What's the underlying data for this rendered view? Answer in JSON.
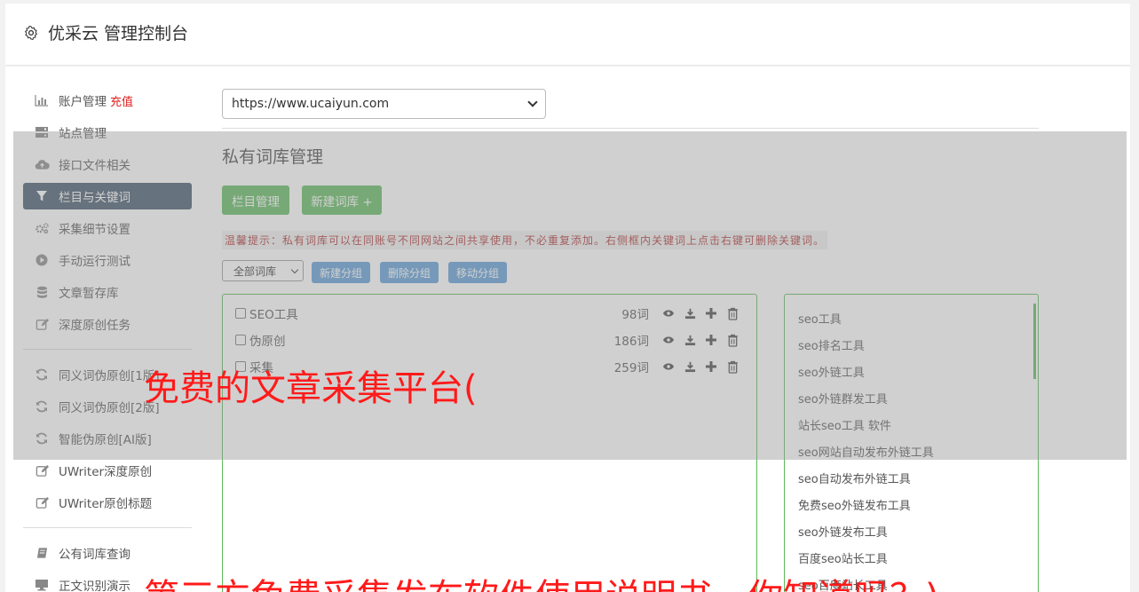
{
  "header": {
    "title": "优采云 管理控制台",
    "icon": "gear-icon"
  },
  "sidebar": {
    "groups": [
      [
        {
          "icon": "bar-chart-icon",
          "label": "账户管理",
          "badge": "充值"
        },
        {
          "icon": "server-icon",
          "label": "站点管理"
        },
        {
          "icon": "cloud-upload-icon",
          "label": "接口文件相关"
        },
        {
          "icon": "filter-icon",
          "label": "栏目与关键词",
          "active": true
        },
        {
          "icon": "cogs-icon",
          "label": "采集细节设置"
        },
        {
          "icon": "play-circle-icon",
          "label": "手动运行测试"
        },
        {
          "icon": "database-icon",
          "label": "文章暂存库"
        },
        {
          "icon": "edit-icon",
          "label": "深度原创任务"
        }
      ],
      [
        {
          "icon": "refresh-icon",
          "label": "同义词伪原创[1版]"
        },
        {
          "icon": "refresh-icon",
          "label": "同义词伪原创[2版]"
        },
        {
          "icon": "refresh-icon",
          "label": "智能伪原创[AI版]"
        },
        {
          "icon": "edit-icon",
          "label": "UWriter深度原创"
        },
        {
          "icon": "edit-icon",
          "label": "UWriter原创标题"
        }
      ],
      [
        {
          "icon": "book-icon",
          "label": "公有词库查询"
        },
        {
          "icon": "monitor-icon",
          "label": "正文识别演示"
        }
      ]
    ]
  },
  "content": {
    "site_select": {
      "value": "https://www.ucaiyun.com"
    },
    "section_title": "私有词库管理",
    "buttons": {
      "column_manage": "栏目管理",
      "new_library": "新建词库 +"
    },
    "tip": "温馨提示：私有词库可以在同账号不同网站之间共享使用，不必重复添加。右侧框内关键词上点击右键可删除关键词。",
    "group_select": {
      "value": "全部词库"
    },
    "group_buttons": {
      "new_group": "新建分组",
      "delete_group": "删除分组",
      "move_group": "移动分组"
    },
    "libraries": [
      {
        "name": "SEO工具",
        "count": "98词"
      },
      {
        "name": "伪原创",
        "count": "186词"
      },
      {
        "name": "采集",
        "count": "259词"
      }
    ],
    "keywords": [
      "seo工具",
      "seo排名工具",
      "seo外链工具",
      "seo外链群发工具",
      "站长seo工具 软件",
      "seo网站自动发布外链工具",
      "seo自动发布外链工具",
      "免费seo外链发布工具",
      "seo外链发布工具",
      "百度seo站长工具",
      "seo百度站长工具"
    ]
  },
  "watermarks": {
    "line1": "免费的文章采集平台(",
    "line2_left": "第三方免费采集发布软件使用说明书",
    "line2_right": "你知道吗？)"
  },
  "colors": {
    "green": "#5cb85c",
    "blue": "#5b9bd5",
    "active_nav": "#3e5468",
    "watermark": "#ff1a1a",
    "tip": "#b03030"
  }
}
